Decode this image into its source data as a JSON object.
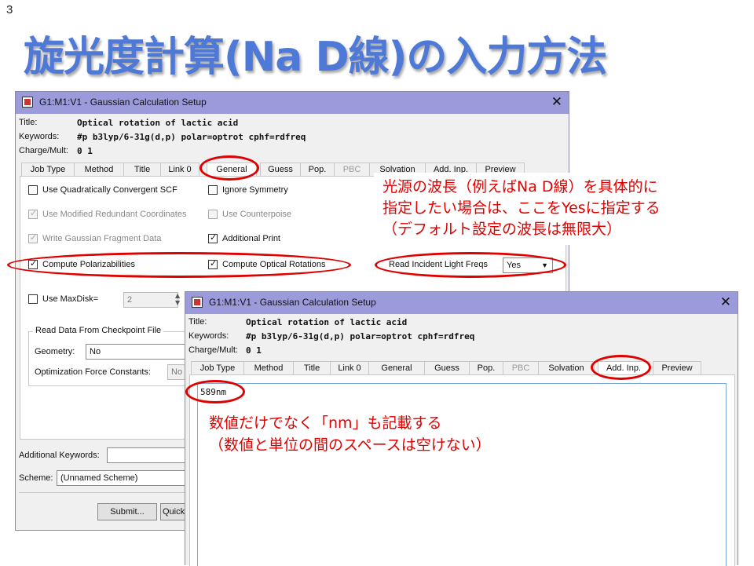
{
  "slide": {
    "number": "3",
    "title": "旋光度計算(Na D線)の入力方法"
  },
  "win1": {
    "title": "G1:M1:V1 - Gaussian Calculation Setup",
    "title_label": "Title:",
    "title_value": "Optical rotation of lactic acid",
    "keywords_label": "Keywords:",
    "keywords_value": "#p b3lyp/6-31g(d,p) polar=optrot cphf=rdfreq",
    "charge_label": "Charge/Mult:",
    "charge_value": "0 1",
    "tabs": [
      "Job Type",
      "Method",
      "Title",
      "Link 0",
      "General",
      "Guess",
      "Pop.",
      "PBC",
      "Solvation",
      "Add. Inp.",
      "Preview"
    ],
    "active_tab": "General",
    "options": {
      "quad_scf": "Use Quadratically Convergent SCF",
      "ignore_symmetry": "Ignore Symmetry",
      "modified_redundant": "Use Modified Redundant Coordinates",
      "counterpoise": "Use Counterpoise",
      "write_fragment": "Write Gaussian Fragment Data",
      "additional_print": "Additional Print",
      "polarizabilities": "Compute Polarizabilities",
      "optical_rotations": "Compute Optical Rotations",
      "read_incident": "Read Incident Light Freqs",
      "read_incident_value": "Yes",
      "maxdisk": "Use MaxDisk=",
      "maxdisk_value": "2"
    },
    "checkpoint": {
      "group_title": "Read Data From Checkpoint File",
      "geometry_label": "Geometry:",
      "geometry_value": "No",
      "force_label": "Optimization Force Constants:",
      "force_value": "No"
    },
    "additional_keywords_label": "Additional Keywords:",
    "scheme_label": "Scheme:",
    "scheme_value": "(Unnamed Scheme)",
    "submit_label": "Submit...",
    "quick_label": "Quick"
  },
  "win2": {
    "title": "G1:M1:V1 - Gaussian Calculation Setup",
    "title_label": "Title:",
    "title_value": "Optical rotation of lactic acid",
    "keywords_label": "Keywords:",
    "keywords_value": "#p b3lyp/6-31g(d,p) polar=optrot cphf=rdfreq",
    "charge_label": "Charge/Mult:",
    "charge_value": "0 1",
    "tabs": [
      "Job Type",
      "Method",
      "Title",
      "Link 0",
      "General",
      "Guess",
      "Pop.",
      "PBC",
      "Solvation",
      "Add. Inp.",
      "Preview"
    ],
    "active_tab": "Add. Inp.",
    "add_input_text": "589nm"
  },
  "annotations": {
    "note1_line1": "光源の波長（例えばNa D線）を具体的に",
    "note1_line2": "指定したい場合は、ここをYesに指定する",
    "note1_line3": "（デフォルト設定の波長は無限大）",
    "note2_line1": "数値だけでなく「nm」も記載する",
    "note2_line2": "（数値と単位の間のスペースは空けない）"
  },
  "colors": {
    "title_blue": "#4e79d7",
    "titlebar": "#9b9bdc",
    "annotation_red": "#e00000"
  }
}
